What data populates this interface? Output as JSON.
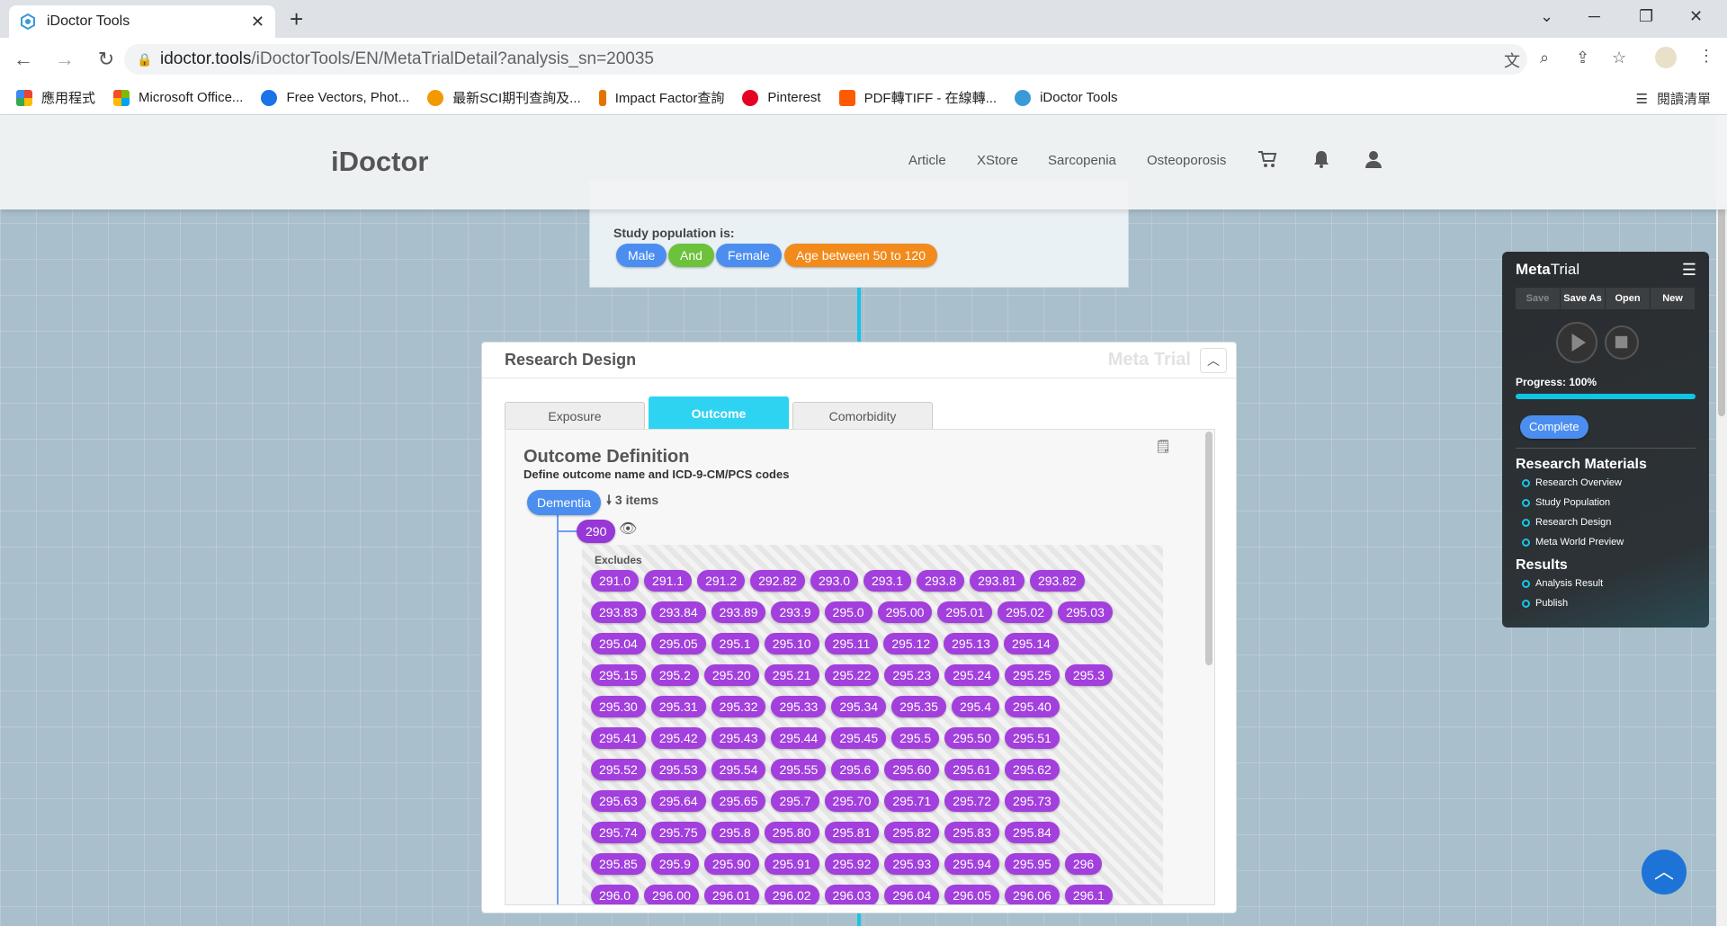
{
  "browser": {
    "tab_title": "iDoctor Tools",
    "url_host": "idoctor.tools",
    "url_path": "/iDoctorTools/EN/MetaTrialDetail?analysis_sn=20035",
    "bookmarks": [
      {
        "label": "應用程式",
        "color": "#e8453c"
      },
      {
        "label": "Microsoft Office...",
        "color": "#f25022"
      },
      {
        "label": "Free Vectors, Phot...",
        "color": "#1a73e8"
      },
      {
        "label": "最新SCI期刊查詢及...",
        "color": "#f29900"
      },
      {
        "label": "Impact Factor查詢",
        "color": "#e37400"
      },
      {
        "label": "Pinterest",
        "color": "#e60023"
      },
      {
        "label": "PDF轉TIFF - 在線轉...",
        "color": "#ff5a00"
      },
      {
        "label": "iDoctor Tools",
        "color": "#3a9ad9"
      }
    ],
    "reading_list": "閱讀清單"
  },
  "site": {
    "logo": "iDoctor",
    "nav": [
      "Article",
      "XStore",
      "Sarcopenia",
      "Osteoporosis"
    ]
  },
  "population": {
    "label": "Study population is:",
    "pills": [
      {
        "text": "Male",
        "color": "#4b8ef0"
      },
      {
        "text": "And",
        "color": "#6cc23a"
      },
      {
        "text": "Female",
        "color": "#4b8ef0"
      },
      {
        "text": "Age between 50 to 120",
        "color": "#f28a1c"
      }
    ]
  },
  "research_design": {
    "title": "Research Design",
    "watermark": "Meta Trial",
    "tabs": [
      "Exposure",
      "Outcome",
      "Comorbidity"
    ],
    "active_tab": "Outcome",
    "outcome_title": "Outcome Definition",
    "outcome_subtitle": "Define outcome name and ICD-9-CM/PCS codes",
    "outcome_name": "Dementia",
    "items_count": "3 items",
    "root_code": "290",
    "excludes_label": "Excludes",
    "excludes": [
      [
        "291.0",
        "291.1",
        "291.2",
        "292.82",
        "293.0",
        "293.1",
        "293.8",
        "293.81",
        "293.82"
      ],
      [
        "293.83",
        "293.84",
        "293.89",
        "293.9",
        "295.0",
        "295.00",
        "295.01",
        "295.02",
        "295.03"
      ],
      [
        "295.04",
        "295.05",
        "295.1",
        "295.10",
        "295.11",
        "295.12",
        "295.13",
        "295.14"
      ],
      [
        "295.15",
        "295.2",
        "295.20",
        "295.21",
        "295.22",
        "295.23",
        "295.24",
        "295.25",
        "295.3"
      ],
      [
        "295.30",
        "295.31",
        "295.32",
        "295.33",
        "295.34",
        "295.35",
        "295.4",
        "295.40"
      ],
      [
        "295.41",
        "295.42",
        "295.43",
        "295.44",
        "295.45",
        "295.5",
        "295.50",
        "295.51"
      ],
      [
        "295.52",
        "295.53",
        "295.54",
        "295.55",
        "295.6",
        "295.60",
        "295.61",
        "295.62"
      ],
      [
        "295.63",
        "295.64",
        "295.65",
        "295.7",
        "295.70",
        "295.71",
        "295.72",
        "295.73"
      ],
      [
        "295.74",
        "295.75",
        "295.8",
        "295.80",
        "295.81",
        "295.82",
        "295.83",
        "295.84"
      ],
      [
        "295.85",
        "295.9",
        "295.90",
        "295.91",
        "295.92",
        "295.93",
        "295.94",
        "295.95",
        "296"
      ],
      [
        "296.0",
        "296.00",
        "296.01",
        "296.02",
        "296.03",
        "296.04",
        "296.05",
        "296.06",
        "296.1"
      ]
    ]
  },
  "metatrial": {
    "title_bold": "Meta",
    "title_rest": "Trial",
    "buttons": [
      "Save",
      "Save As",
      "Open",
      "New"
    ],
    "progress_label": "Progress: 100%",
    "progress": 1.0,
    "status": "Complete",
    "materials_title": "Research Materials",
    "materials": [
      "Research Overview",
      "Study Population",
      "Research Design",
      "Meta World Preview"
    ],
    "results_title": "Results",
    "results": [
      "Analysis Result",
      "Publish"
    ]
  }
}
